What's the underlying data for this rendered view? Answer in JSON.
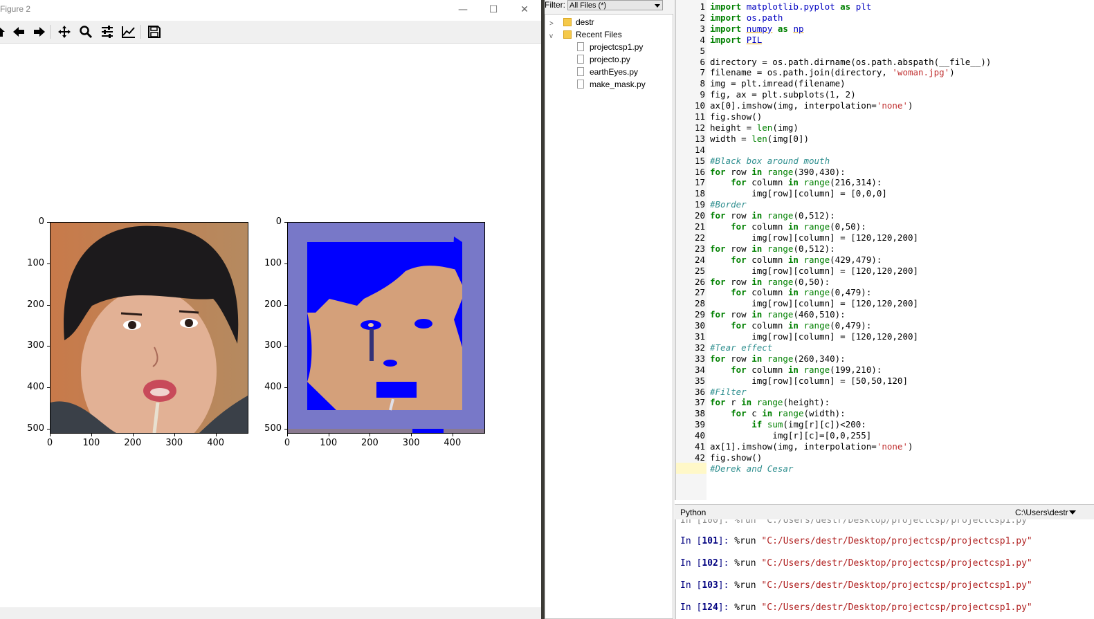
{
  "figure_window": {
    "title": "Figure 2",
    "controls": {
      "minimize": "—",
      "maximize": "☐",
      "close": "✕"
    },
    "toolbar_icons": [
      "home-icon",
      "back-arrow-icon",
      "forward-arrow-icon",
      "pan-icon",
      "zoom-icon",
      "configure-subplots-icon",
      "edit-axes-icon",
      "save-icon"
    ],
    "left_axes": {
      "yticks": [
        "0",
        "100",
        "200",
        "300",
        "400",
        "500"
      ],
      "xticks": [
        "0",
        "100",
        "200",
        "300",
        "400"
      ]
    },
    "right_axes": {
      "yticks": [
        "0",
        "100",
        "200",
        "300",
        "400",
        "500"
      ],
      "xticks": [
        "0",
        "100",
        "200",
        "300",
        "400"
      ]
    },
    "colors": {
      "border_fill": "#7878c8",
      "filter_blue": "#0000ff",
      "tear": "#323278",
      "mouth_box": "#0000ff"
    }
  },
  "file_browser": {
    "filter_label": "Filter:",
    "filter_value": "All Files (*)",
    "tree": [
      {
        "label": "destr",
        "type": "folder",
        "expanded": false
      },
      {
        "label": "Recent Files",
        "type": "folder",
        "expanded": true
      },
      {
        "label": "projectcsp1.py",
        "type": "file"
      },
      {
        "label": "projecto.py",
        "type": "file"
      },
      {
        "label": "earthEyes.py",
        "type": "file"
      },
      {
        "label": "make_mask.py",
        "type": "file"
      }
    ]
  },
  "editor": {
    "lines": [
      "import matplotlib.pyplot as plt",
      "import os.path",
      "import numpy as np",
      "import PIL",
      "",
      "directory = os.path.dirname(os.path.abspath(__file__))",
      "filename = os.path.join(directory, 'woman.jpg')",
      "img = plt.imread(filename)",
      "fig, ax = plt.subplots(1, 2)",
      "ax[0].imshow(img, interpolation='none')",
      "fig.show()",
      "height = len(img)",
      "width = len(img[0])",
      "",
      "#Black box around mouth",
      "for row in range(390,430):",
      "    for column in range(216,314):",
      "        img[row][column] = [0,0,0]",
      "#Border",
      "for row in range(0,512):",
      "    for column in range(0,50):",
      "        img[row][column] = [120,120,200]",
      "for row in range(0,512):",
      "    for column in range(429,479):",
      "        img[row][column] = [120,120,200]",
      "for row in range(0,50):",
      "    for column in range(0,479):",
      "        img[row][column] = [120,120,200]",
      "for row in range(460,510):",
      "    for column in range(0,479):",
      "        img[row][column] = [120,120,200]",
      "#Tear effect",
      "for row in range(260,340):",
      "    for column in range(199,210):",
      "        img[row][column] = [50,50,120]",
      "#Filter",
      "for r in range(height):",
      "    for c in range(width):",
      "        if sum(img[r][c])<200:",
      "            img[r][c]=[0,0,255]",
      "ax[1].imshow(img, interpolation='none')",
      "fig.show()",
      "#Derek and Cesar"
    ]
  },
  "console": {
    "language": "Python",
    "path": "C:\\Users\\destr",
    "entries": [
      {
        "prompt_num": "101",
        "command": "%run",
        "arg": "\"C:/Users/destr/Desktop/projectcsp/projectcsp1.py\""
      },
      {
        "prompt_num": "102",
        "command": "%run",
        "arg": "\"C:/Users/destr/Desktop/projectcsp/projectcsp1.py\""
      },
      {
        "prompt_num": "103",
        "command": "%run",
        "arg": "\"C:/Users/destr/Desktop/projectcsp/projectcsp1.py\""
      },
      {
        "prompt_num": "124",
        "command": "%run",
        "arg": "\"C:/Users/destr/Desktop/projectcsp/projectcsp1.py\""
      }
    ]
  }
}
